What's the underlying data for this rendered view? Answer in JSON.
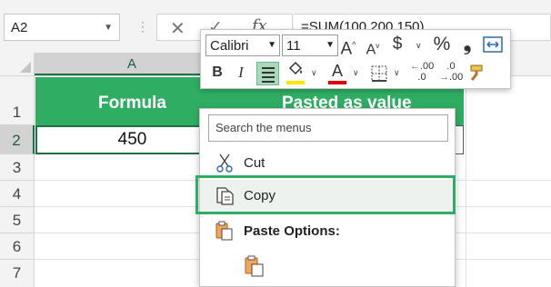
{
  "formula_bar": {
    "name_box": "A2",
    "formula": "=SUM(100,200,150)",
    "separator": "⋮",
    "cancel_glyph": "✕",
    "enter_glyph": "✓",
    "fx_glyph": "fx"
  },
  "grid": {
    "columns": [
      "A"
    ],
    "rows": [
      "1",
      "2",
      "3",
      "4",
      "5",
      "6",
      "7"
    ],
    "cells": {
      "A1": "Formula",
      "B1": "Pasted as value",
      "A2": "450"
    }
  },
  "mini_toolbar": {
    "font_name": "Calibri",
    "font_size": "11",
    "grow_font": "A",
    "shrink_font": "A",
    "currency": "$",
    "percent": "%",
    "comma": "❟",
    "bold": "B",
    "italic": "I",
    "font_color_letter": "A",
    "increase_decimal": ".00",
    "decrease_decimal": ".0",
    "icons": [
      "wrap-text-icon",
      "align-center-icon",
      "fill-color-icon",
      "font-color-icon",
      "borders-icon",
      "format-painter-icon"
    ],
    "colors": {
      "fill": "#ffe500",
      "font": "#e00000"
    }
  },
  "context_menu": {
    "search_placeholder": "Search the menus",
    "items": [
      {
        "label": "Cut",
        "icon": "scissors-icon"
      },
      {
        "label": "Copy",
        "icon": "copy-icon"
      }
    ],
    "paste_options_label": "Paste Options:"
  },
  "colors": {
    "header_fill": "#2fae63",
    "selection": "#1e7145",
    "highlight_outline": "#2fae63"
  }
}
